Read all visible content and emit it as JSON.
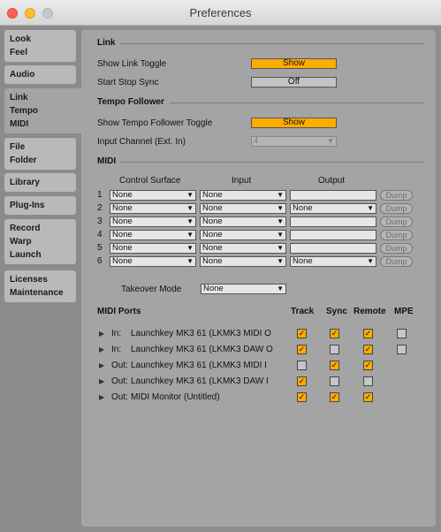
{
  "window": {
    "title": "Preferences"
  },
  "sidebar": {
    "tabs": [
      {
        "lines": [
          "Look",
          "Feel"
        ]
      },
      {
        "lines": [
          "Audio"
        ]
      },
      {
        "lines": [
          "Link",
          "Tempo",
          "MIDI"
        ]
      },
      {
        "lines": [
          "File",
          "Folder"
        ]
      },
      {
        "lines": [
          "Library"
        ]
      },
      {
        "lines": [
          "Plug-Ins"
        ]
      },
      {
        "lines": [
          "Record",
          "Warp",
          "Launch"
        ]
      },
      {
        "lines": [
          "Licenses",
          "Maintenance"
        ]
      }
    ]
  },
  "link": {
    "heading": "Link",
    "show_toggle_label": "Show Link Toggle",
    "show_toggle_value": "Show",
    "start_stop_label": "Start Stop Sync",
    "start_stop_value": "Off"
  },
  "tempo": {
    "heading": "Tempo Follower",
    "show_toggle_label": "Show Tempo Follower Toggle",
    "show_toggle_value": "Show",
    "input_channel_label": "Input Channel (Ext. In)",
    "input_channel_value": "4"
  },
  "midi": {
    "heading": "MIDI",
    "col_control_surface": "Control Surface",
    "col_input": "Input",
    "col_output": "Output",
    "dump_label": "Dump",
    "rows": [
      {
        "n": "1",
        "surface": "None",
        "input": "None",
        "output": ""
      },
      {
        "n": "2",
        "surface": "None",
        "input": "None",
        "output": "None"
      },
      {
        "n": "3",
        "surface": "None",
        "input": "None",
        "output": ""
      },
      {
        "n": "4",
        "surface": "None",
        "input": "None",
        "output": ""
      },
      {
        "n": "5",
        "surface": "None",
        "input": "None",
        "output": ""
      },
      {
        "n": "6",
        "surface": "None",
        "input": "None",
        "output": "None"
      }
    ],
    "takeover_label": "Takeover Mode",
    "takeover_value": "None"
  },
  "ports": {
    "heading": "MIDI Ports",
    "col_track": "Track",
    "col_sync": "Sync",
    "col_remote": "Remote",
    "col_mpe": "MPE",
    "rows": [
      {
        "dir": "In:",
        "name": "Launchkey MK3 61 (LKMK3 MIDI O",
        "track": true,
        "sync": true,
        "remote": true,
        "mpe": false
      },
      {
        "dir": "In:",
        "name": "Launchkey MK3 61 (LKMK3 DAW O",
        "track": true,
        "sync": false,
        "remote": true,
        "mpe": false
      },
      {
        "dir": "Out:",
        "name": "Launchkey MK3 61 (LKMK3 MIDI I",
        "track": false,
        "sync": true,
        "remote": true
      },
      {
        "dir": "Out:",
        "name": "Launchkey MK3 61 (LKMK3 DAW I",
        "track": true,
        "sync": false,
        "remote": false
      },
      {
        "dir": "Out:",
        "name": "MIDI Monitor (Untitled)",
        "track": true,
        "sync": true,
        "remote": true
      }
    ]
  },
  "icons": {
    "check": "✓",
    "dropdown": "▼",
    "expand": "▶"
  },
  "colors": {
    "accent": "#ffac00",
    "panel": "#a4a4a4"
  }
}
